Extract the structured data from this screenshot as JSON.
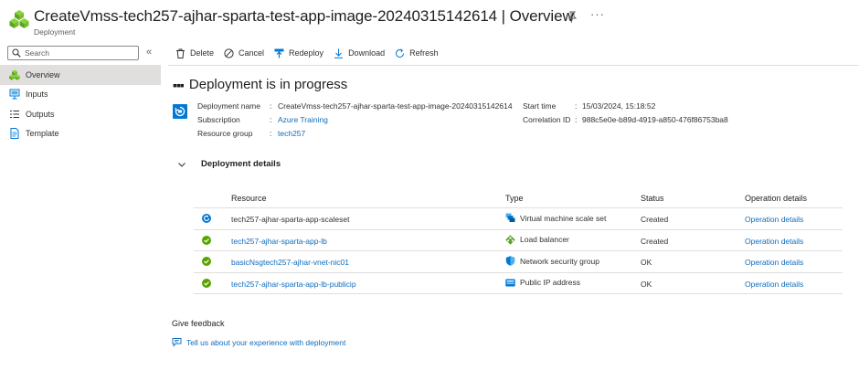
{
  "header": {
    "title": "CreateVmss-tech257-ajhar-sparta-test-app-image-20240315142614 | Overview",
    "subtitle": "Deployment",
    "more": "···"
  },
  "sidebar": {
    "search_placeholder": "Search",
    "collapse": "«",
    "items": [
      {
        "label": "Overview",
        "icon": "overview-icon"
      },
      {
        "label": "Inputs",
        "icon": "inputs-icon"
      },
      {
        "label": "Outputs",
        "icon": "outputs-icon"
      },
      {
        "label": "Template",
        "icon": "template-icon"
      }
    ]
  },
  "toolbar": {
    "delete": "Delete",
    "cancel": "Cancel",
    "redeploy": "Redeploy",
    "download": "Download",
    "refresh": "Refresh"
  },
  "status": {
    "dots": "▪▪▪",
    "title": "Deployment is in progress"
  },
  "info": {
    "deployment_name_label": "Deployment name",
    "deployment_name": "CreateVmss-tech257-ajhar-sparta-test-app-image-20240315142614",
    "subscription_label": "Subscription",
    "subscription": "Azure Training",
    "resource_group_label": "Resource group",
    "resource_group": "tech257",
    "start_time_label": "Start time",
    "start_time": "15/03/2024, 15:18:52",
    "correlation_label": "Correlation ID",
    "correlation_id": "988c5e0e-b89d-4919-a850-476f86753ba8"
  },
  "details": {
    "title": "Deployment details",
    "columns": {
      "resource": "Resource",
      "type": "Type",
      "status": "Status",
      "operation": "Operation details"
    },
    "rows": [
      {
        "resource": "tech257-ajhar-sparta-app-scaleset",
        "type": "Virtual machine scale set",
        "status": "Created",
        "operation": "Operation details",
        "state": "in-progress"
      },
      {
        "resource": "tech257-ajhar-sparta-app-lb",
        "type": "Load balancer",
        "status": "Created",
        "operation": "Operation details",
        "state": "success"
      },
      {
        "resource": "basicNsgtech257-ajhar-vnet-nic01",
        "type": "Network security group",
        "status": "OK",
        "operation": "Operation details",
        "state": "success"
      },
      {
        "resource": "tech257-ajhar-sparta-app-lb-publicip",
        "type": "Public IP address",
        "status": "OK",
        "operation": "Operation details",
        "state": "success"
      }
    ]
  },
  "feedback": {
    "title": "Give feedback",
    "link": "Tell us about your experience with deployment"
  },
  "colors": {
    "accent": "#0f6cbd",
    "success": "#57a300",
    "text": "#323130"
  }
}
